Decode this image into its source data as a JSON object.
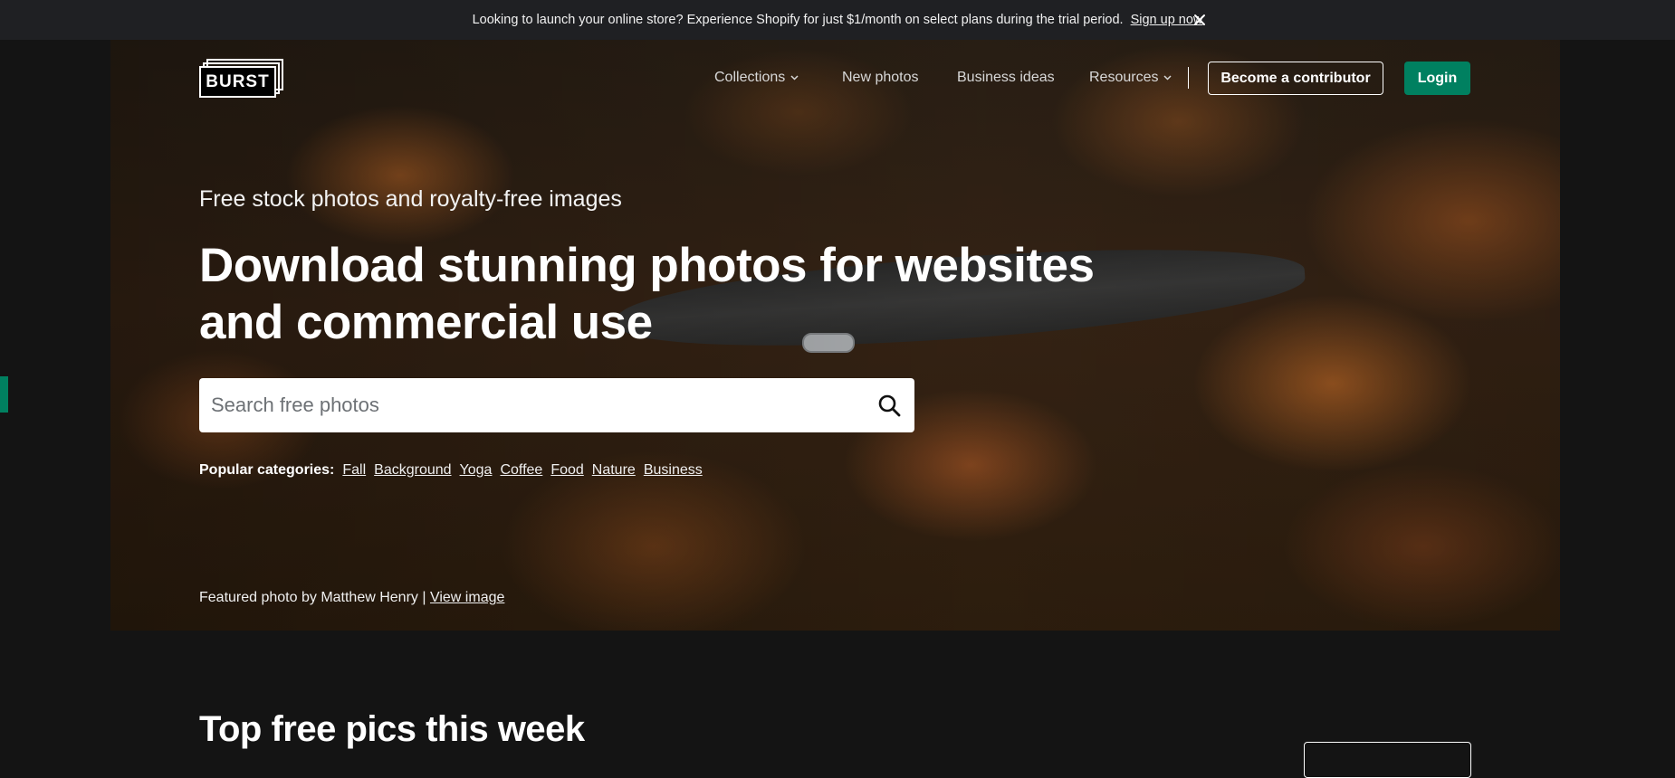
{
  "announcement": {
    "text": "Looking to launch your online store? Experience Shopify for just $1/month on select plans during the trial period.",
    "link_label": "Sign up now",
    "close_icon": "close-icon"
  },
  "header": {
    "logo_text": "BURST",
    "nav": {
      "collections": "Collections",
      "new_photos": "New photos",
      "business_ideas": "Business ideas",
      "resources": "Resources"
    },
    "contributor_label": "Become a contributor",
    "login_label": "Login"
  },
  "hero": {
    "eyebrow": "Free stock photos and royalty-free images",
    "headline": "Download stunning photos for websites and commercial use",
    "search": {
      "placeholder": "Search free photos",
      "value": "",
      "icon": "search-icon"
    },
    "popular_label": "Popular categories:",
    "categories": [
      "Fall",
      "Background",
      "Yoga",
      "Coffee",
      "Food",
      "Nature",
      "Business"
    ],
    "credit_text": "Featured photo by Matthew Henry |",
    "credit_link": "View image"
  },
  "section": {
    "title": "Top free pics this week"
  },
  "colors": {
    "accent": "#008060",
    "announce_bg": "#1f2023",
    "page_bg": "#141414"
  }
}
